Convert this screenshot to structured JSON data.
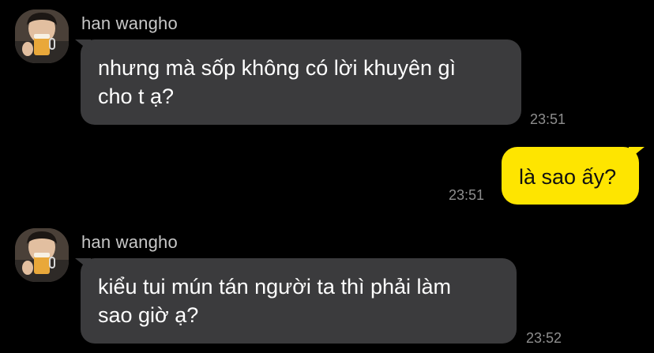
{
  "messages": [
    {
      "sender": "han wangho",
      "text": "nhưng mà sốp không có lời khuyên gì cho t ạ?",
      "line1": "nhưng mà sốp không có lời khuyên gì",
      "line2": "cho t ạ?",
      "time": "23:51",
      "avatar_icon": "profile-photo-person-drinking-beer"
    },
    {
      "sender": "me",
      "text": "là sao ấy?",
      "time": "23:51",
      "bubble_color": "#fee500"
    },
    {
      "sender": "han wangho",
      "text": "kiểu tui mún tán người ta thì phải làm sao giờ ạ?",
      "line1": "kiểu tui mún tán người ta thì phải làm",
      "line2": "sao giờ ạ?",
      "time": "23:52",
      "avatar_icon": "profile-photo-person-drinking-beer"
    }
  ],
  "theme": {
    "background": "#000000",
    "incoming_bubble": "#3b3b3d",
    "outgoing_bubble": "#fee500"
  }
}
